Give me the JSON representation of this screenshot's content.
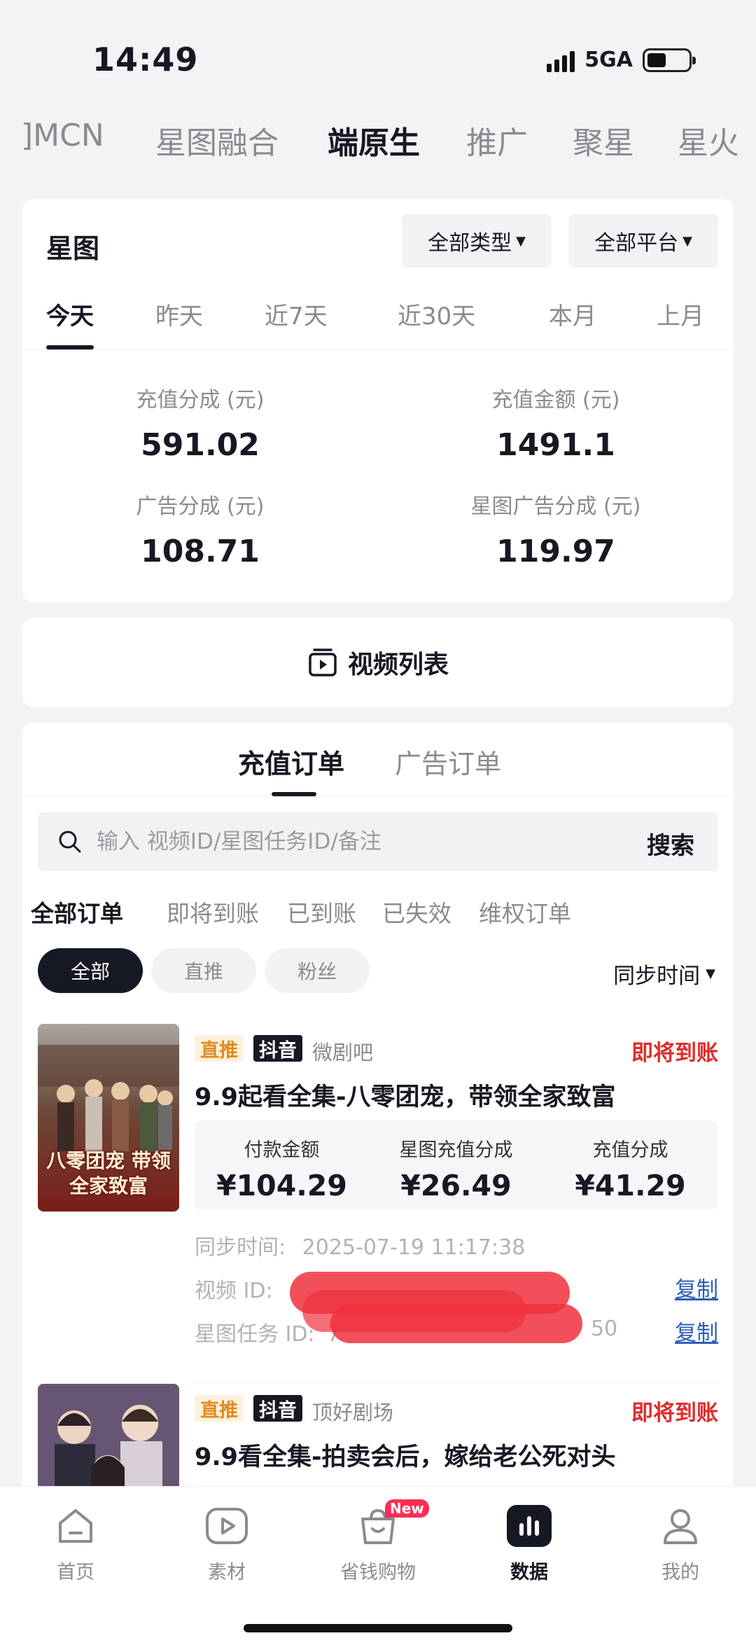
{
  "status_bar": {
    "time": "14:49",
    "network": "5GA"
  },
  "category_tabs": [
    {
      "label": "MCN"
    },
    {
      "label": "星图融合"
    },
    {
      "label": "端原生"
    },
    {
      "label": "推广"
    },
    {
      "label": "聚星"
    },
    {
      "label": "星火"
    }
  ],
  "stats": {
    "title": "星图",
    "type_filter": "全部类型",
    "platform_filter": "全部平台",
    "periods": [
      "今天",
      "昨天",
      "近7天",
      "近30天",
      "本月",
      "上月"
    ],
    "metrics": [
      {
        "label": "充值分成 (元)",
        "value": "591.02"
      },
      {
        "label": "充值金额 (元)",
        "value": "1491.1"
      },
      {
        "label": "广告分成 (元)",
        "value": "108.71"
      },
      {
        "label": "星图广告分成 (元)",
        "value": "119.97"
      }
    ]
  },
  "video_list": {
    "label": "视频列表"
  },
  "orders": {
    "tabs": [
      "充值订单",
      "广告订单"
    ],
    "search": {
      "placeholder": "输入 视频ID/星图任务ID/备注",
      "button": "搜索"
    },
    "status_filters": [
      "全部订单",
      "即将到账",
      "已到账",
      "已失效",
      "维权订单"
    ],
    "chips": [
      "全部",
      "直推",
      "粉丝"
    ],
    "sort_label": "同步时间",
    "items": [
      {
        "tag": "直推",
        "platform": "抖音",
        "source": "微剧吧",
        "status": "即将到账",
        "title": "9.9起看全集-八零团宠，带领全家致富",
        "poster_text": "八零团宠 带领全家致富",
        "amounts": [
          {
            "label": "付款金额",
            "value": "¥104.29"
          },
          {
            "label": "星图充值分成",
            "value": "¥26.49"
          },
          {
            "label": "充值分成",
            "value": "¥41.29"
          }
        ],
        "sync_label": "同步时间:",
        "sync_time": "2025-07-19 11:17:38",
        "video_id_label": "视频 ID:",
        "task_id_label": "星图任务 ID:",
        "task_id_visible_prefix": "7",
        "task_id_visible_suffix": "50",
        "copy_label": "复制"
      },
      {
        "tag": "直推",
        "platform": "抖音",
        "source": "顶好剧场",
        "status": "即将到账",
        "title": "9.9看全集-拍卖会后，嫁给老公死对头"
      }
    ]
  },
  "bottom_nav": [
    {
      "label": "首页",
      "icon": "home-icon"
    },
    {
      "label": "素材",
      "icon": "play-icon"
    },
    {
      "label": "省钱购物",
      "icon": "shopping-bag-icon",
      "badge": "New"
    },
    {
      "label": "数据",
      "icon": "bar-chart-icon"
    },
    {
      "label": "我的",
      "icon": "user-icon"
    }
  ],
  "colors": {
    "accent_red": "#e22b2b",
    "link_blue": "#2f5fb7",
    "tag_orange": "#e28a1f",
    "badge_pink": "#fe2c55"
  }
}
